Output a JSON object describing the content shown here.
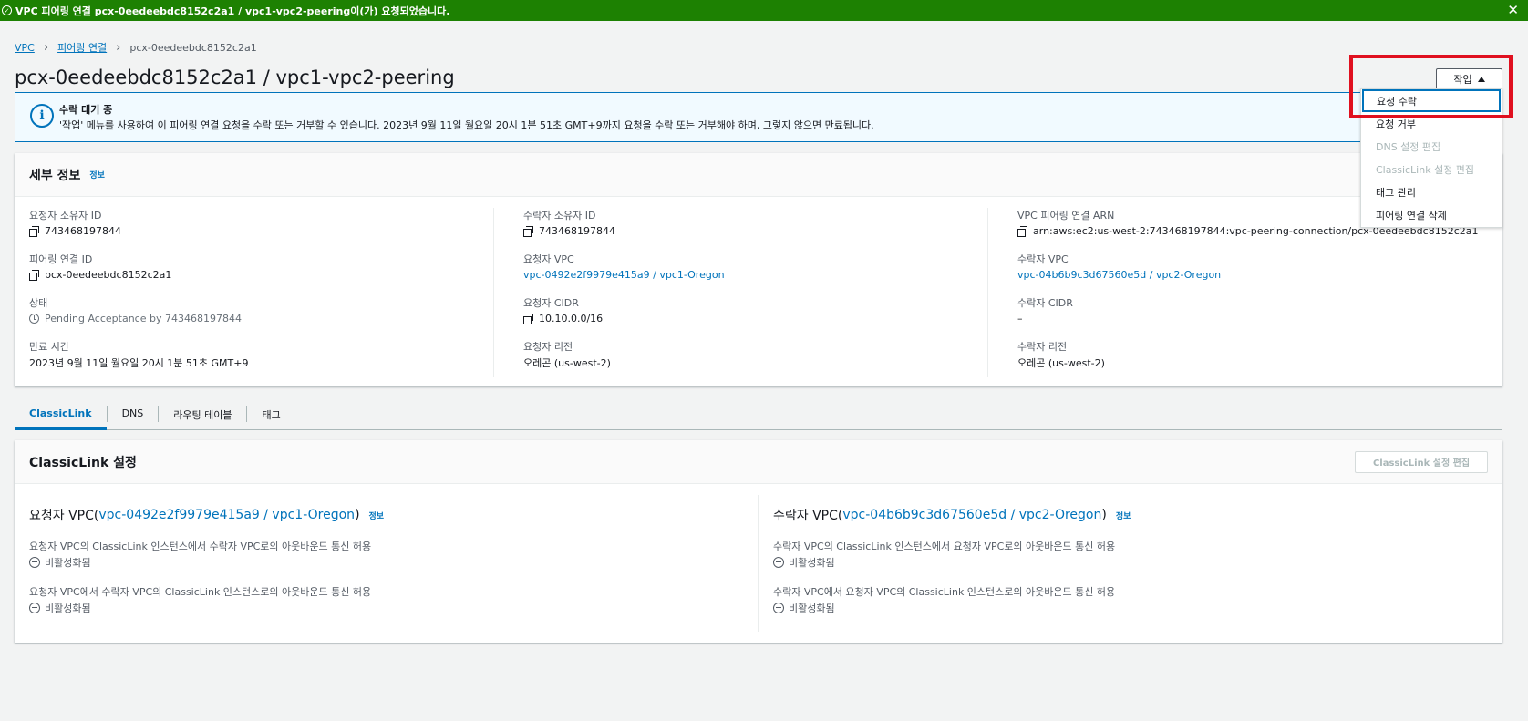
{
  "flash": {
    "message": "VPC 피어링 연결 pcx-0eedeebdc8152c2a1 / vpc1-vpc2-peering이(가) 요청되었습니다.",
    "close": "✕"
  },
  "breadcrumb": {
    "vpc": "VPC",
    "peering": "피어링 연결",
    "current": "pcx-0eedeebdc8152c2a1"
  },
  "page_title": "pcx-0eedeebdc8152c2a1 / vpc1-vpc2-peering",
  "actions": {
    "label": "작업",
    "items": [
      {
        "label": "요청 수락",
        "state": "active"
      },
      {
        "label": "요청 거부",
        "state": "enabled"
      },
      {
        "label": "DNS 설정 편집",
        "state": "disabled"
      },
      {
        "label": "ClassicLink 설정 편집",
        "state": "disabled"
      },
      {
        "label": "태그 관리",
        "state": "enabled"
      },
      {
        "label": "피어링 연결 삭제",
        "state": "enabled"
      }
    ]
  },
  "alert": {
    "title": "수락 대기 중",
    "body": "'작업' 메뉴를 사용하여 이 피어링 연결 요청을 수락 또는 거부할 수 있습니다. 2023년 9월 11일 월요일 20시 1분 51초 GMT+9까지 요청을 수락 또는 거부해야 하며, 그렇지 않으면 만료됩니다."
  },
  "details": {
    "title": "세부 정보",
    "info": "정보",
    "requester_owner_label": "요청자 소유자 ID",
    "requester_owner": "743468197844",
    "peering_id_label": "피어링 연결 ID",
    "peering_id": "pcx-0eedeebdc8152c2a1",
    "status_label": "상태",
    "status": "Pending Acceptance by 743468197844",
    "expiry_label": "만료 시간",
    "expiry": "2023년 9월 11일 월요일 20시 1분 51초 GMT+9",
    "accepter_owner_label": "수락자 소유자 ID",
    "accepter_owner": "743468197844",
    "requester_vpc_label": "요청자 VPC",
    "requester_vpc": "vpc-0492e2f9979e415a9 / vpc1-Oregon",
    "requester_cidr_label": "요청자 CIDR",
    "requester_cidr": "10.10.0.0/16",
    "requester_region_label": "요청자 리전",
    "requester_region": "오레곤 (us-west-2)",
    "arn_label": "VPC 피어링 연결 ARN",
    "arn": "arn:aws:ec2:us-west-2:743468197844:vpc-peering-connection/pcx-0eedeebdc8152c2a1",
    "accepter_vpc_label": "수락자 VPC",
    "accepter_vpc": "vpc-04b6b9c3d67560e5d / vpc2-Oregon",
    "accepter_cidr_label": "수락자 CIDR",
    "accepter_cidr": "–",
    "accepter_region_label": "수락자 리전",
    "accepter_region": "오레곤 (us-west-2)"
  },
  "tabs": [
    "ClassicLink",
    "DNS",
    "라우팅 테이블",
    "태그"
  ],
  "classiclink": {
    "title": "ClassicLink 설정",
    "edit_button": "ClassicLink 설정 편집",
    "info": "정보",
    "requester": {
      "prefix": "요청자 VPC(",
      "link": "vpc-0492e2f9979e415a9 / vpc1-Oregon",
      "suffix": ")",
      "field1_label": "요청자 VPC의 ClassicLink 인스턴스에서 수락자 VPC로의 아웃바운드 통신 허용",
      "field1_value": "비활성화됨",
      "field2_label": "요청자 VPC에서 수락자 VPC의 ClassicLink 인스턴스로의 아웃바운드 통신 허용",
      "field2_value": "비활성화됨"
    },
    "accepter": {
      "prefix": "수락자 VPC(",
      "link": "vpc-04b6b9c3d67560e5d / vpc2-Oregon",
      "suffix": ")",
      "field1_label": "수락자 VPC의 ClassicLink 인스턴스에서 요청자 VPC로의 아웃바운드 통신 허용",
      "field1_value": "비활성화됨",
      "field2_label": "수락자 VPC에서 요청자 VPC의 ClassicLink 인스턴스로의 아웃바운드 통신 허용",
      "field2_value": "비활성화됨"
    }
  }
}
